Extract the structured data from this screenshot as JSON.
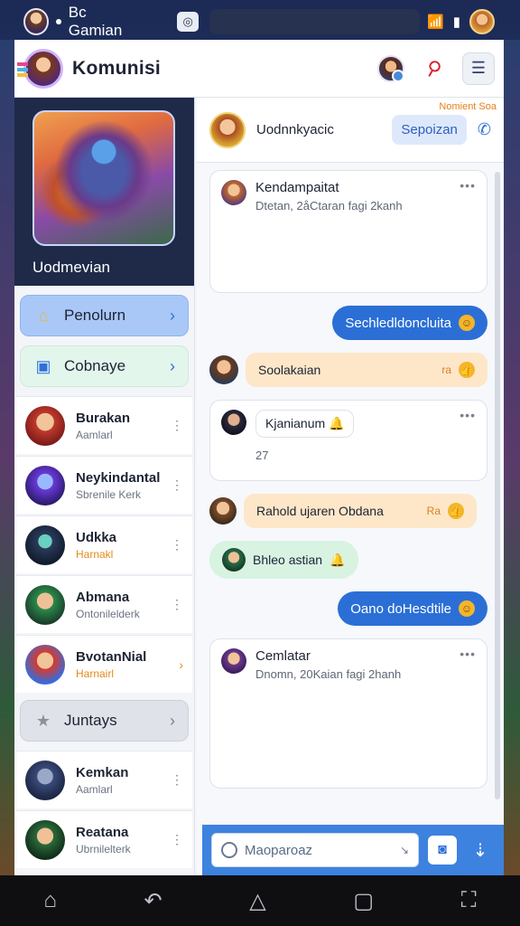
{
  "status_bar": {
    "title": "Bc Gamian"
  },
  "app": {
    "title": "Komunisi"
  },
  "hero": {
    "name": "Uodmevian"
  },
  "sidebar": {
    "primary_button": "Penolurn",
    "secondary_button": "Cobnaye",
    "group_button": "Juntays"
  },
  "contacts": [
    {
      "name": "Burakan",
      "sub": "Aamlarl",
      "color": "#c0392b"
    },
    {
      "name": "Neykindantal",
      "sub": "Sbrenile Kerk",
      "color": "#6a3ad8"
    },
    {
      "name": "Udkka",
      "sub": "Harnakl",
      "sub_orange": true,
      "color": "#2a3a5a"
    },
    {
      "name": "Abmana",
      "sub": "Ontonilelderk",
      "color": "#2a8a4a"
    },
    {
      "name": "BvotanNial",
      "sub": "Harnairl",
      "sub_orange": true,
      "color": "#d83a2a"
    },
    {
      "name": "Kemkan",
      "sub": "Aamlarl",
      "color": "#3a4a7a"
    },
    {
      "name": "Reatana",
      "sub": "Ubrnilelterk",
      "color": "#2a6a3a"
    }
  ],
  "chat": {
    "contact_name": "Uodnnkyacic",
    "top_link": "Nomient Soa",
    "action_button": "Sepoizan",
    "messages": {
      "card1_title": "Kendampaitat",
      "card1_sub": "Dtetan, 2åCtaran fagi 2kanh",
      "blue1": "Sechledldoncluita",
      "peach1": "Soolakaian",
      "peach1_tag": "ra",
      "card2_title": "Kjanianum",
      "card2_note": "27",
      "peach2": "Rahold ujaren Obdana",
      "peach2_tag": "Ra",
      "green1": "Bhleo astian",
      "blue2": "Oano doHesdtile",
      "card3_title": "Cemlatar",
      "card3_sub": "Dnomn, 20Kaian fagi 2hanh"
    },
    "composer_placeholder": "Maoparoaz"
  }
}
